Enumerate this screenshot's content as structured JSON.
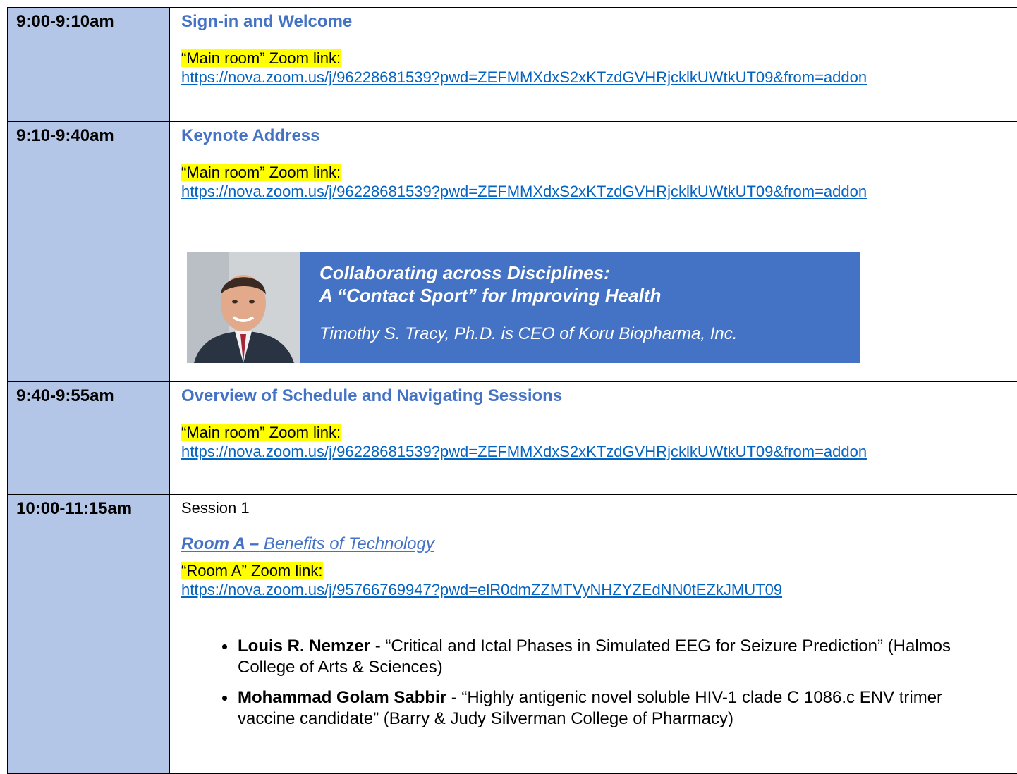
{
  "rows": [
    {
      "time": "9:00-9:10am",
      "title": "Sign-in and Welcome",
      "zoom_label": "“Main room” Zoom link:",
      "zoom_url": "https://nova.zoom.us/j/96228681539?pwd=ZEFMMXdxS2xKTzdGVHRjcklkUWtkUT09&from=addon"
    },
    {
      "time": "9:10-9:40am",
      "title": "Keynote Address",
      "zoom_label": "“Main room” Zoom link:",
      "zoom_url": "https://nova.zoom.us/j/96228681539?pwd=ZEFMMXdxS2xKTzdGVHRjcklkUWtkUT09&from=addon",
      "keynote": {
        "line1": "Collaborating across Disciplines:",
        "line2": "A “Contact Sport” for Improving Health",
        "speaker": "Timothy S. Tracy, Ph.D. is CEO of Koru Biopharma, Inc."
      }
    },
    {
      "time": "9:40-9:55am",
      "title": "Overview of Schedule and Navigating Sessions",
      "zoom_label": "“Main room” Zoom link:",
      "zoom_url": "https://nova.zoom.us/j/96228681539?pwd=ZEFMMXdxS2xKTzdGVHRjcklkUWtkUT09&from=addon"
    },
    {
      "time": "10:00-11:15am",
      "session": "Session 1",
      "room_prefix": "Room A –",
      "room_title": " Benefits of Technology",
      "zoom_label": "“Room A” Zoom link:",
      "zoom_url": "https://nova.zoom.us/j/95766769947?pwd=elR0dmZZMTVyNHZYZEdNN0tEZkJMUT09",
      "talks": [
        {
          "speaker": "Louis R. Nemzer",
          "rest": " - “Critical and Ictal Phases in Simulated EEG for Seizure Prediction” (Halmos College of Arts & Sciences)"
        },
        {
          "speaker": "Mohammad Golam Sabbir",
          "rest": " - “Highly antigenic novel soluble HIV-1 clade C 1086.c ENV trimer vaccine candidate” (Barry & Judy Silverman College of Pharmacy)"
        }
      ]
    }
  ]
}
